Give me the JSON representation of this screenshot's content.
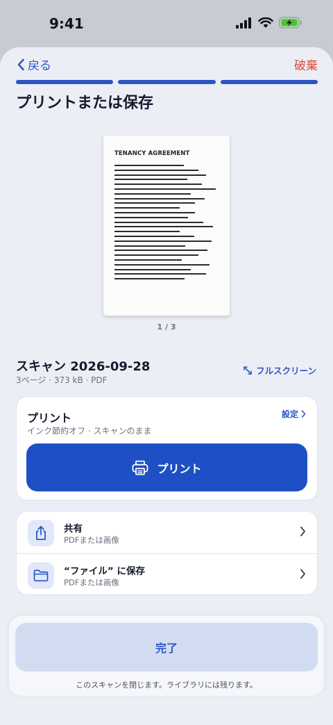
{
  "status_bar": {
    "time": "9:41",
    "icons": [
      "signal-icon",
      "wifi-icon",
      "battery-charging-icon"
    ]
  },
  "nav": {
    "back_label": "戻る",
    "discard_label": "破棄",
    "progress_steps": 3,
    "progress_completed": 3
  },
  "page": {
    "title": "プリントまたは保存"
  },
  "preview": {
    "doc_heading": "TENANCY AGREEMENT",
    "page_indicator": "1 / 3"
  },
  "file": {
    "name": "スキャン 2026-09-28",
    "meta": "3ページ · 373 kB · PDF",
    "fullscreen_label": "フルスクリーン"
  },
  "print": {
    "title": "プリント",
    "subtitle": "インク節約オフ · スキャンのまま",
    "settings_label": "設定",
    "button_label": "プリント"
  },
  "actions": [
    {
      "title": "共有",
      "subtitle": "PDFまたは画像",
      "icon": "share-icon"
    },
    {
      "title": "“ファイル” に保存",
      "subtitle": "PDFまたは画像",
      "icon": "folder-icon"
    }
  ],
  "footer": {
    "done_label": "完了",
    "hint": "このスキャンを閉じます。ライブラリには残ります。"
  },
  "colors": {
    "accent": "#1f4fc4",
    "link": "#2d57c4",
    "destructive": "#e5453a",
    "sheet_background": "#eceef6",
    "done_button_background": "#d2dcf1"
  }
}
